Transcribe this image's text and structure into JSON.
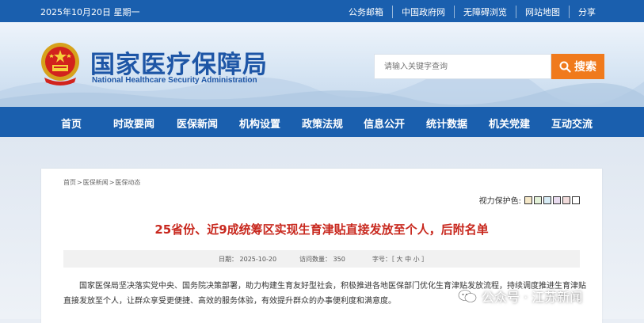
{
  "topbar": {
    "date": "2025年10月20日 星期一",
    "links": [
      "公务邮箱",
      "中国政府网",
      "无障碍浏览",
      "网站地图",
      "分享"
    ]
  },
  "header": {
    "title_cn": "国家医疗保障局",
    "title_en": "National Healthcare Security Administration",
    "search_placeholder": "请输入关键字查询",
    "search_button": "搜索"
  },
  "nav": [
    "首页",
    "时政要闻",
    "医保新闻",
    "机构设置",
    "政策法规",
    "信息公开",
    "统计数据",
    "机关党建",
    "互动交流"
  ],
  "breadcrumb": [
    "首页",
    "医保新闻",
    "医保动态"
  ],
  "view_protection": {
    "label": "视力保护色:",
    "colors": [
      "#f5e8c8",
      "#e3f1d8",
      "#d8ecf5",
      "#e9dcef",
      "#f2dcdc",
      "#ffffff"
    ]
  },
  "article": {
    "title": "25省份、近9成统筹区实现生育津贴直接发放至个人，后附名单",
    "meta_date": "日期：  2025-10-20",
    "meta_views": "访问数量：  350",
    "meta_fontsize": "字号：［ 大 中 小 ］",
    "body": "国家医保局坚决落实党中央、国务院决策部署，助力构建生育友好型社会，积极推进各地医保部门优化生育津贴发放流程，持续调度推进生育津贴直接发放至个人，让群众享受更便捷、高效的服务体验，有效提升群众的办事便利度和满意度。"
  },
  "watermark": "公众号 · 江苏新闻"
}
